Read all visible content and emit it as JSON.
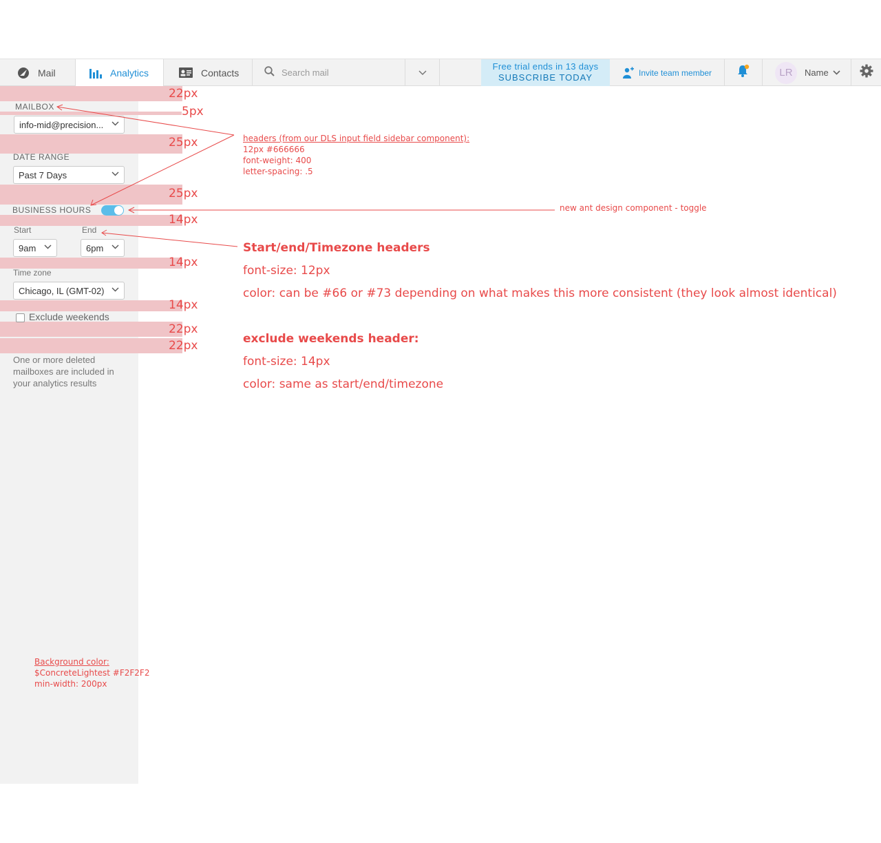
{
  "nav": {
    "mail": "Mail",
    "analytics": "Analytics",
    "contacts": "Contacts",
    "search_placeholder": "Search mail",
    "trial_line1": "Free trial ends in 13 days",
    "trial_line2": "SUBSCRIBE TODAY",
    "invite": "Invite team member",
    "avatar_initials": "LR",
    "user_name": "Name"
  },
  "sidebar": {
    "mailbox_header": "MAILBOX",
    "mailbox_value": "info-mid@precision...",
    "date_range_header": "DATE RANGE",
    "date_range_value": "Past 7 Days",
    "business_hours_header": "BUSINESS HOURS",
    "business_hours_on": true,
    "start_header": "Start",
    "start_value": "9am",
    "end_header": "End",
    "end_value": "6pm",
    "timezone_header": "Time zone",
    "timezone_value": "Chicago, IL (GMT-02)",
    "exclude_weekends": "Exclude weekends",
    "deleted_note": "One or more deleted mailboxes are included in your analytics results"
  },
  "spacing": {
    "s1": "22px",
    "s2": "5px",
    "s3": "25px",
    "s4": "25px",
    "s5": "14px",
    "s6": "14px",
    "s7": "14px",
    "s8": "22px",
    "s9": "22px"
  },
  "annotations": {
    "headers_title": "headers (from our DLS input field sidebar component):",
    "headers_line1": "12px #666666",
    "headers_line2": "font-weight: 400",
    "headers_line3": "letter-spacing: .5",
    "toggle_note": "new ant design component - toggle",
    "sub_title": "Start/end/Timezone headers",
    "sub_line1": "font-size: 12px",
    "sub_line2": "color: can be #66 or #73 depending on what makes this more consistent (they look almost identical)",
    "ex_title": "exclude weekends header:",
    "ex_line1": "font-size: 14px",
    "ex_line2": "color: same as start/end/timezone",
    "bg_title": "Background color:",
    "bg_line1": "$ConcreteLightest #F2F2F2",
    "bg_line2": "min-width: 200px"
  },
  "colors": {
    "accent": "#1f8fd6",
    "annotation": "#e84a4a",
    "sidebar_bg": "#F2F2F2",
    "toggle": "#5bbde9"
  }
}
